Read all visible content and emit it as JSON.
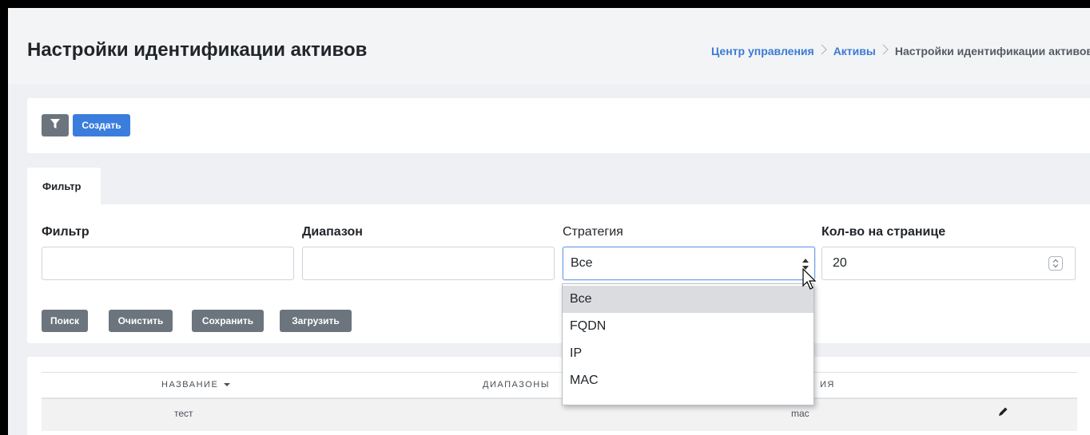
{
  "header": {
    "title": "Настройки идентификации активов",
    "breadcrumb": [
      "Центр управления",
      "Активы",
      "Настройки идентификации активов"
    ],
    "separator": ">"
  },
  "toolbar": {
    "filter_icon": "filter-icon",
    "create_label": "Создать"
  },
  "filter_panel": {
    "tab_label": "Фильтр",
    "fields": {
      "filter_label": "Фильтр",
      "filter_value": "",
      "range_label": "Диапазон",
      "range_value": "",
      "strategy_label": "Стратегия",
      "strategy_value": "Все",
      "per_page_label": "Кол-во на странице",
      "per_page_value": "20"
    },
    "buttons": {
      "search": "Поиск",
      "clear": "Очистить",
      "save": "Сохранить",
      "load": "Загрузить"
    }
  },
  "strategy_dropdown": {
    "options": [
      "Все",
      "FQDN",
      "IP",
      "MAC"
    ],
    "selected_index": 0
  },
  "table": {
    "columns": [
      "НАЗВАНИЕ",
      "ДИАПАЗОНЫ",
      "ИЯ"
    ],
    "rows": [
      {
        "name": "тест",
        "ranges": "",
        "strategy": "mac",
        "action_icon": "pencil-icon"
      }
    ]
  },
  "colors": {
    "primary": "#3b7ddd",
    "secondary": "#6c757d",
    "link": "#3b7bd4",
    "page_bg": "#eef0f3"
  }
}
